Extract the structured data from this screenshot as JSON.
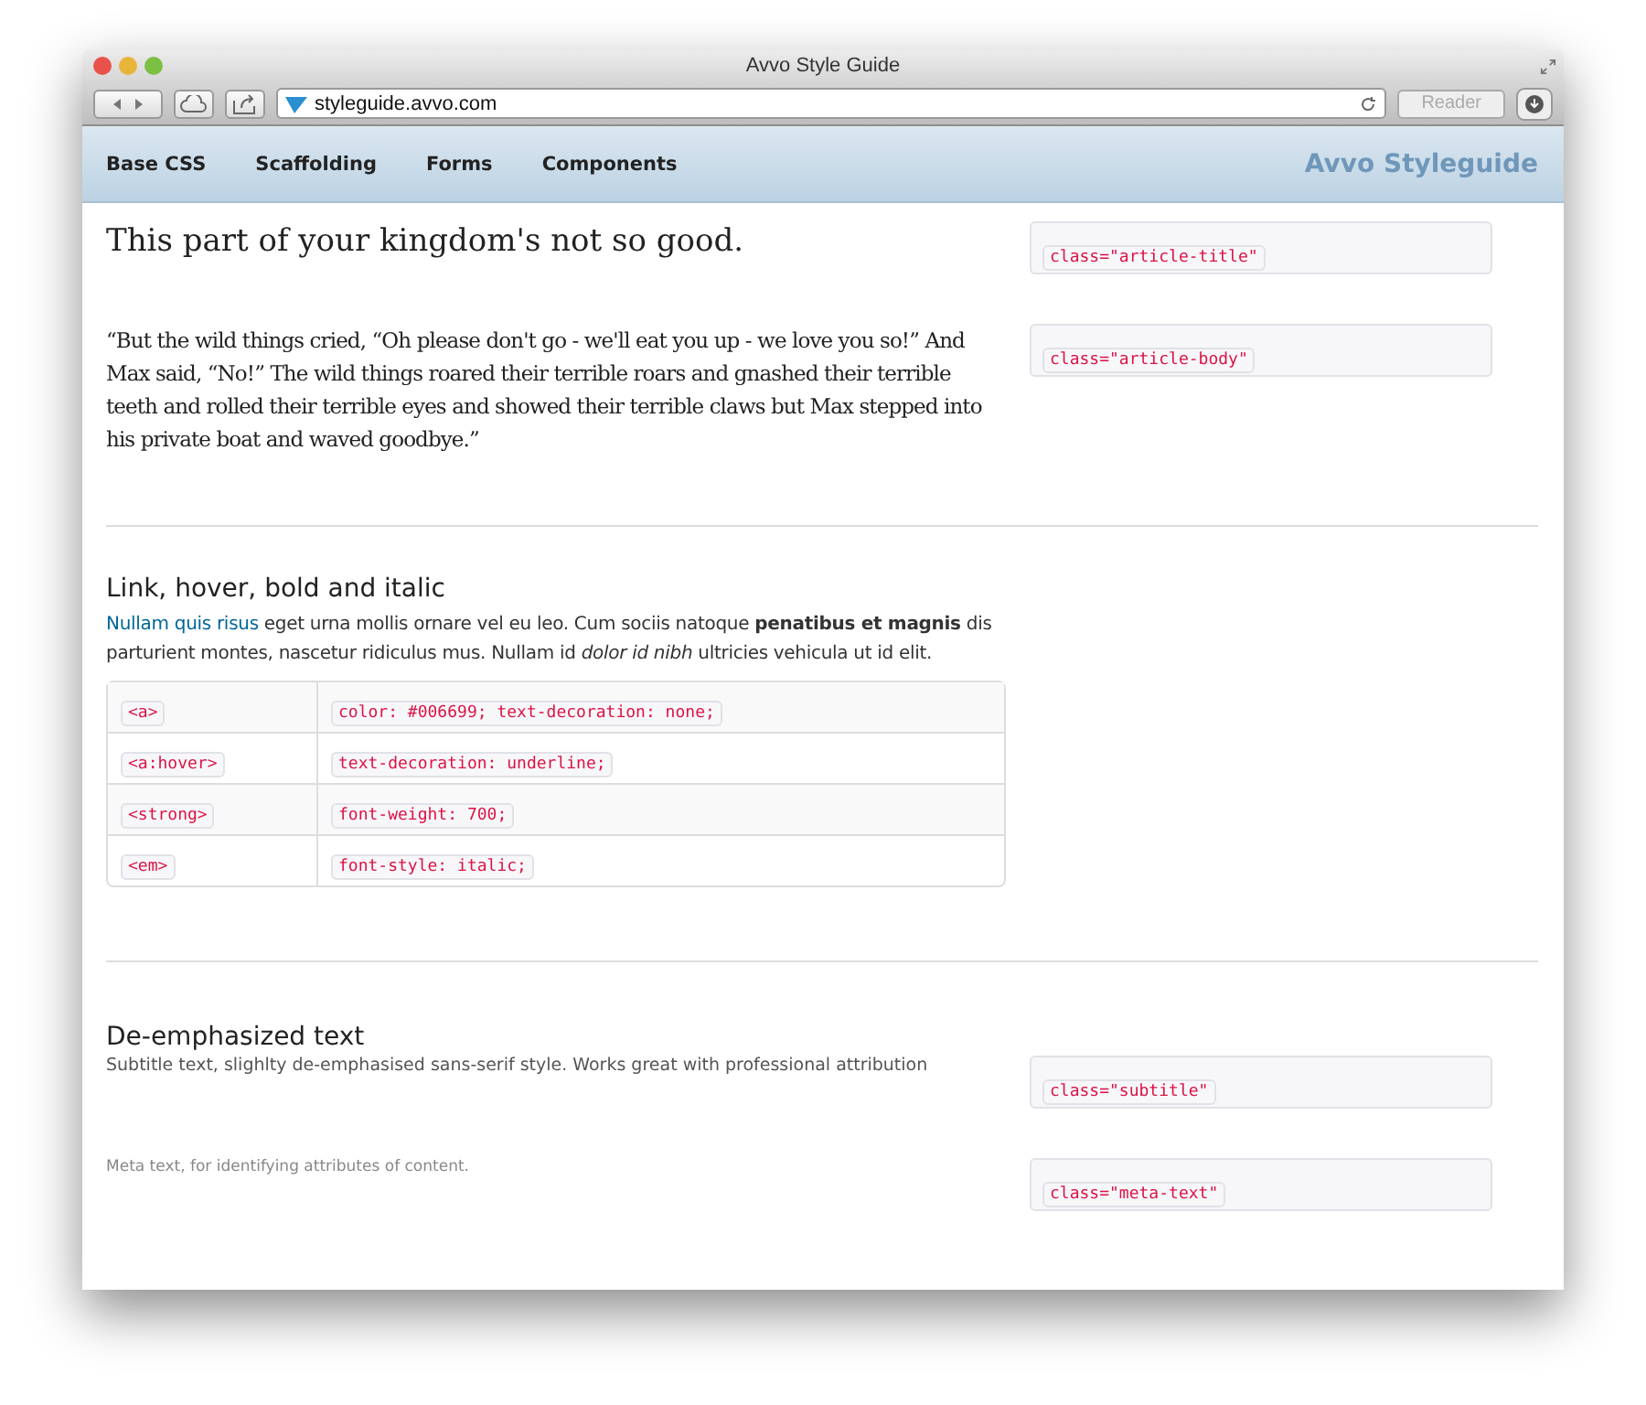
{
  "window": {
    "title": "Avvo Style Guide"
  },
  "toolbar": {
    "url": "styleguide.avvo.com",
    "reader_button": "Reader"
  },
  "nav": {
    "items": [
      "Base CSS",
      "Scaffolding",
      "Forms",
      "Components"
    ],
    "brand": "Avvo Styleguide"
  },
  "sections": [
    {
      "kind": "samples",
      "rows": [
        {
          "kind": "title",
          "text": "This part of your kingdom's not so good.",
          "code": "class=\"article-title\""
        },
        {
          "kind": "body",
          "text": "“But the wild things cried, “Oh please don't go - we'll eat you up - we love you so!” And Max said, “No!” The wild things roared their terrible roars and gnashed their terrible teeth and rolled their terrible eyes and showed their terrible claws but Max stepped into his private boat and waved goodbye.”",
          "code": "class=\"article-body\""
        }
      ]
    },
    {
      "kind": "table",
      "heading": "Link, hover, bold and italic",
      "link": "Nullam quis risus",
      "text": " eget urna mollis ornare vel eu leo. Cum sociis natoque **penatibus et magnis** dis parturient montes, nascetur ridiculus mus. Nullam id *dolor id nibh* ultricies vehicula ut id elit.",
      "rows": [
        {
          "tag": "<a>",
          "css": "color: #006699; text-decoration: none;"
        },
        {
          "tag": "<a:hover>",
          "css": "text-decoration: underline;"
        },
        {
          "tag": "<strong>",
          "css": "font-weight: 700;"
        },
        {
          "tag": "<em>",
          "css": "font-style: italic;"
        }
      ]
    },
    {
      "kind": "samples",
      "heading": "De-emphasized text",
      "rows": [
        {
          "kind": "subtitle",
          "text": "Subtitle text, slighlty de-emphasised sans-serif style. Works great with professional attribution",
          "code": "class=\"subtitle\""
        },
        {
          "kind": "meta",
          "text": "Meta text, for identifying attributes of content.",
          "code": "class=\"meta-text\""
        }
      ]
    }
  ]
}
